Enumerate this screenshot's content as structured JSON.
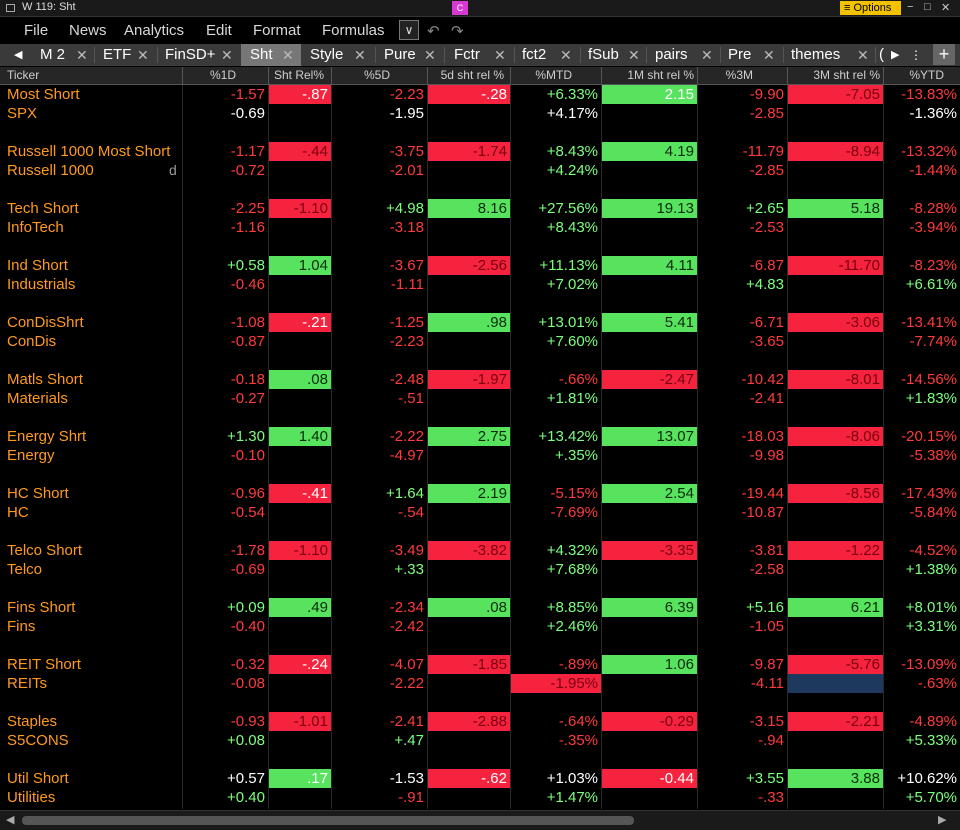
{
  "window": {
    "title": "W 119: Sht",
    "badge": "C",
    "options_label": "≡ Options",
    "minimize": "−",
    "maximize": "□",
    "close": "✕"
  },
  "menu": [
    "File",
    "News",
    "Analytics",
    "Edit",
    "Format",
    "Formulas"
  ],
  "tabs": [
    {
      "label": "M 2",
      "close": "✕"
    },
    {
      "label": "ETF",
      "close": "✕"
    },
    {
      "label": "FinSD+",
      "close": "✕"
    },
    {
      "label": "Sht",
      "close": "✕",
      "active": true
    },
    {
      "label": "Style",
      "close": "✕"
    },
    {
      "label": "Pure",
      "close": "✕"
    },
    {
      "label": "Fctr",
      "close": "✕"
    },
    {
      "label": "fct2",
      "close": "✕"
    },
    {
      "label": "fSub",
      "close": "✕"
    },
    {
      "label": "pairs",
      "close": "✕"
    },
    {
      "label": "Pre",
      "close": "✕"
    },
    {
      "label": "themes",
      "close": "✕"
    },
    {
      "label": "(",
      "close": ""
    }
  ],
  "columns": [
    "Ticker",
    "%1D",
    "Sht Rel%",
    "%5D",
    "5d sht rel %",
    "%MTD",
    "1M sht rel %",
    "%3M",
    "3M sht rel %",
    "%YTD"
  ],
  "rows": [
    {
      "name": "Most Short",
      "short": true,
      "cells": [
        [
          "-1.57",
          "r",
          ""
        ],
        [
          "-.87",
          "w",
          "R"
        ],
        [
          "-2.23",
          "r",
          ""
        ],
        [
          "-.28",
          "w",
          "R"
        ],
        [
          "+6.33%",
          "g",
          ""
        ],
        [
          "2.15",
          "w",
          "G"
        ],
        [
          "-9.90",
          "r",
          ""
        ],
        [
          "-7.05",
          "r",
          "R"
        ],
        [
          "-13.83%",
          "r",
          ""
        ]
      ]
    },
    {
      "name": "SPX",
      "short": false,
      "cells": [
        [
          "-0.69",
          "w",
          ""
        ],
        [
          "",
          "",
          ""
        ],
        [
          "-1.95",
          "w",
          ""
        ],
        [
          "",
          "",
          ""
        ],
        [
          "+4.17%",
          "w",
          ""
        ],
        [
          "",
          "",
          ""
        ],
        [
          "-2.85",
          "r",
          ""
        ],
        [
          "",
          "",
          ""
        ],
        [
          "-1.36%",
          "w",
          ""
        ]
      ]
    },
    null,
    {
      "name": "Russell 1000 Most Short",
      "short": true,
      "cells": [
        [
          "-1.17",
          "r",
          ""
        ],
        [
          "-.44",
          "r",
          "R"
        ],
        [
          "-3.75",
          "r",
          ""
        ],
        [
          "-1.74",
          "r",
          "R"
        ],
        [
          "+8.43%",
          "g",
          ""
        ],
        [
          "4.19",
          "k",
          "G"
        ],
        [
          "-11.79",
          "r",
          ""
        ],
        [
          "-8.94",
          "r",
          "R"
        ],
        [
          "-13.32%",
          "r",
          ""
        ]
      ]
    },
    {
      "name": "Russell 1000",
      "short": false,
      "d": "d",
      "cells": [
        [
          "-0.72",
          "r",
          ""
        ],
        [
          "",
          "",
          ""
        ],
        [
          "-2.01",
          "r",
          ""
        ],
        [
          "",
          "",
          ""
        ],
        [
          "+4.24%",
          "g",
          ""
        ],
        [
          "",
          "",
          ""
        ],
        [
          "-2.85",
          "r",
          ""
        ],
        [
          "",
          "",
          ""
        ],
        [
          "-1.44%",
          "r",
          ""
        ]
      ]
    },
    null,
    {
      "name": "Tech Short",
      "short": true,
      "cells": [
        [
          "-2.25",
          "r",
          ""
        ],
        [
          "-1.10",
          "r",
          "R"
        ],
        [
          "+4.98",
          "g",
          ""
        ],
        [
          "8.16",
          "k",
          "G"
        ],
        [
          "+27.56%",
          "g",
          ""
        ],
        [
          "19.13",
          "k",
          "G"
        ],
        [
          "+2.65",
          "g",
          ""
        ],
        [
          "5.18",
          "k",
          "G"
        ],
        [
          "-8.28%",
          "r",
          ""
        ]
      ]
    },
    {
      "name": "InfoTech",
      "short": false,
      "cells": [
        [
          "-1.16",
          "r",
          ""
        ],
        [
          "",
          "",
          ""
        ],
        [
          "-3.18",
          "r",
          ""
        ],
        [
          "",
          "",
          ""
        ],
        [
          "+8.43%",
          "g",
          ""
        ],
        [
          "",
          "",
          ""
        ],
        [
          "-2.53",
          "r",
          ""
        ],
        [
          "",
          "",
          ""
        ],
        [
          "-3.94%",
          "r",
          ""
        ]
      ]
    },
    null,
    {
      "name": "Ind Short",
      "short": true,
      "cells": [
        [
          "+0.58",
          "g",
          ""
        ],
        [
          "1.04",
          "k",
          "G"
        ],
        [
          "-3.67",
          "r",
          ""
        ],
        [
          "-2.56",
          "r",
          "R"
        ],
        [
          "+11.13%",
          "g",
          ""
        ],
        [
          "4.11",
          "k",
          "G"
        ],
        [
          "-6.87",
          "r",
          ""
        ],
        [
          "-11.70",
          "r",
          "R"
        ],
        [
          "-8.23%",
          "r",
          ""
        ]
      ]
    },
    {
      "name": "Industrials",
      "short": false,
      "cells": [
        [
          "-0.46",
          "r",
          ""
        ],
        [
          "",
          "",
          ""
        ],
        [
          "-1.11",
          "r",
          ""
        ],
        [
          "",
          "",
          ""
        ],
        [
          "+7.02%",
          "g",
          ""
        ],
        [
          "",
          "",
          ""
        ],
        [
          "+4.83",
          "g",
          ""
        ],
        [
          "",
          "",
          ""
        ],
        [
          "+6.61%",
          "g",
          ""
        ]
      ]
    },
    null,
    {
      "name": "ConDisShrt",
      "short": true,
      "cells": [
        [
          "-1.08",
          "r",
          ""
        ],
        [
          "-.21",
          "w",
          "R"
        ],
        [
          "-1.25",
          "r",
          ""
        ],
        [
          ".98",
          "k",
          "G"
        ],
        [
          "+13.01%",
          "g",
          ""
        ],
        [
          "5.41",
          "k",
          "G"
        ],
        [
          "-6.71",
          "r",
          ""
        ],
        [
          "-3.06",
          "r",
          "R"
        ],
        [
          "-13.41%",
          "r",
          ""
        ]
      ]
    },
    {
      "name": "ConDis",
      "short": false,
      "cells": [
        [
          "-0.87",
          "r",
          ""
        ],
        [
          "",
          "",
          ""
        ],
        [
          "-2.23",
          "r",
          ""
        ],
        [
          "",
          "",
          ""
        ],
        [
          "+7.60%",
          "g",
          ""
        ],
        [
          "",
          "",
          ""
        ],
        [
          "-3.65",
          "r",
          ""
        ],
        [
          "",
          "",
          ""
        ],
        [
          "-7.74%",
          "r",
          ""
        ]
      ]
    },
    null,
    {
      "name": "Matls Short",
      "short": true,
      "cells": [
        [
          "-0.18",
          "r",
          ""
        ],
        [
          ".08",
          "k",
          "G"
        ],
        [
          "-2.48",
          "r",
          ""
        ],
        [
          "-1.97",
          "r",
          "R"
        ],
        [
          "-.66%",
          "r",
          ""
        ],
        [
          "-2.47",
          "r",
          "R"
        ],
        [
          "-10.42",
          "r",
          ""
        ],
        [
          "-8.01",
          "r",
          "R"
        ],
        [
          "-14.56%",
          "r",
          ""
        ]
      ]
    },
    {
      "name": "Materials",
      "short": false,
      "cells": [
        [
          "-0.27",
          "r",
          ""
        ],
        [
          "",
          "",
          ""
        ],
        [
          "-.51",
          "r",
          ""
        ],
        [
          "",
          "",
          ""
        ],
        [
          "+1.81%",
          "g",
          ""
        ],
        [
          "",
          "",
          ""
        ],
        [
          "-2.41",
          "r",
          ""
        ],
        [
          "",
          "",
          ""
        ],
        [
          "+1.83%",
          "g",
          ""
        ]
      ]
    },
    null,
    {
      "name": "Energy Shrt",
      "short": true,
      "cells": [
        [
          "+1.30",
          "g",
          ""
        ],
        [
          "1.40",
          "k",
          "G"
        ],
        [
          "-2.22",
          "r",
          ""
        ],
        [
          "2.75",
          "k",
          "G"
        ],
        [
          "+13.42%",
          "g",
          ""
        ],
        [
          "13.07",
          "k",
          "G"
        ],
        [
          "-18.03",
          "r",
          ""
        ],
        [
          "-8.06",
          "r",
          "R"
        ],
        [
          "-20.15%",
          "r",
          ""
        ]
      ]
    },
    {
      "name": "Energy",
      "short": false,
      "cells": [
        [
          "-0.10",
          "r",
          ""
        ],
        [
          "",
          "",
          ""
        ],
        [
          "-4.97",
          "r",
          ""
        ],
        [
          "",
          "",
          ""
        ],
        [
          "+.35%",
          "g",
          ""
        ],
        [
          "",
          "",
          ""
        ],
        [
          "-9.98",
          "r",
          ""
        ],
        [
          "",
          "",
          ""
        ],
        [
          "-5.38%",
          "r",
          ""
        ]
      ]
    },
    null,
    {
      "name": "HC Short",
      "short": true,
      "cells": [
        [
          "-0.96",
          "r",
          ""
        ],
        [
          "-.41",
          "w",
          "R"
        ],
        [
          "+1.64",
          "g",
          ""
        ],
        [
          "2.19",
          "k",
          "G"
        ],
        [
          "-5.15%",
          "r",
          ""
        ],
        [
          "2.54",
          "k",
          "G"
        ],
        [
          "-19.44",
          "r",
          ""
        ],
        [
          "-8.56",
          "r",
          "R"
        ],
        [
          "-17.43%",
          "r",
          ""
        ]
      ]
    },
    {
      "name": "HC",
      "short": false,
      "cells": [
        [
          "-0.54",
          "r",
          ""
        ],
        [
          "",
          "",
          ""
        ],
        [
          "-.54",
          "r",
          ""
        ],
        [
          "",
          "",
          ""
        ],
        [
          "-7.69%",
          "r",
          ""
        ],
        [
          "",
          "",
          ""
        ],
        [
          "-10.87",
          "r",
          ""
        ],
        [
          "",
          "",
          ""
        ],
        [
          "-5.84%",
          "r",
          ""
        ]
      ]
    },
    null,
    {
      "name": "Telco Short",
      "short": true,
      "cells": [
        [
          "-1.78",
          "r",
          ""
        ],
        [
          "-1.10",
          "r",
          "R"
        ],
        [
          "-3.49",
          "r",
          ""
        ],
        [
          "-3.82",
          "r",
          "R"
        ],
        [
          "+4.32%",
          "g",
          ""
        ],
        [
          "-3.35",
          "r",
          "R"
        ],
        [
          "-3.81",
          "r",
          ""
        ],
        [
          "-1.22",
          "r",
          "R"
        ],
        [
          "-4.52%",
          "r",
          ""
        ]
      ]
    },
    {
      "name": "Telco",
      "short": false,
      "cells": [
        [
          "-0.69",
          "r",
          ""
        ],
        [
          "",
          "",
          ""
        ],
        [
          "+.33",
          "g",
          ""
        ],
        [
          "",
          "",
          ""
        ],
        [
          "+7.68%",
          "g",
          ""
        ],
        [
          "",
          "",
          ""
        ],
        [
          "-2.58",
          "r",
          ""
        ],
        [
          "",
          "",
          ""
        ],
        [
          "+1.38%",
          "g",
          ""
        ]
      ]
    },
    null,
    {
      "name": "Fins Short",
      "short": true,
      "cells": [
        [
          "+0.09",
          "g",
          ""
        ],
        [
          ".49",
          "k",
          "G"
        ],
        [
          "-2.34",
          "r",
          ""
        ],
        [
          ".08",
          "k",
          "G"
        ],
        [
          "+8.85%",
          "g",
          ""
        ],
        [
          "6.39",
          "k",
          "G"
        ],
        [
          "+5.16",
          "g",
          ""
        ],
        [
          "6.21",
          "k",
          "G"
        ],
        [
          "+8.01%",
          "g",
          ""
        ]
      ]
    },
    {
      "name": "Fins",
      "short": false,
      "cells": [
        [
          "-0.40",
          "r",
          ""
        ],
        [
          "",
          "",
          ""
        ],
        [
          "-2.42",
          "r",
          ""
        ],
        [
          "",
          "",
          ""
        ],
        [
          "+2.46%",
          "g",
          ""
        ],
        [
          "",
          "",
          ""
        ],
        [
          "-1.05",
          "r",
          ""
        ],
        [
          "",
          "",
          ""
        ],
        [
          "+3.31%",
          "g",
          ""
        ]
      ]
    },
    null,
    {
      "name": "REIT Short",
      "short": true,
      "cells": [
        [
          "-0.32",
          "r",
          ""
        ],
        [
          "-.24",
          "w",
          "R"
        ],
        [
          "-4.07",
          "r",
          ""
        ],
        [
          "-1.85",
          "r",
          "R"
        ],
        [
          "-.89%",
          "r",
          ""
        ],
        [
          "1.06",
          "k",
          "G"
        ],
        [
          "-9.87",
          "r",
          ""
        ],
        [
          "-5.76",
          "r",
          "R"
        ],
        [
          "-13.09%",
          "r",
          ""
        ]
      ]
    },
    {
      "name": "REITs",
      "short": false,
      "cells": [
        [
          "-0.08",
          "r",
          ""
        ],
        [
          "",
          "",
          ""
        ],
        [
          "-2.22",
          "r",
          ""
        ],
        [
          "",
          "",
          ""
        ],
        [
          "-1.95%",
          "r",
          "R"
        ],
        [
          "",
          "",
          ""
        ],
        [
          "-4.11",
          "r",
          ""
        ],
        [
          "",
          "",
          "B"
        ],
        [
          "-.63%",
          "r",
          ""
        ]
      ]
    },
    null,
    {
      "name": "Staples",
      "short": true,
      "cells": [
        [
          "-0.93",
          "r",
          ""
        ],
        [
          "-1.01",
          "r",
          "R"
        ],
        [
          "-2.41",
          "r",
          ""
        ],
        [
          "-2.88",
          "r",
          "R"
        ],
        [
          "-.64%",
          "r",
          ""
        ],
        [
          "-0.29",
          "r",
          "R"
        ],
        [
          "-3.15",
          "r",
          ""
        ],
        [
          "-2.21",
          "r",
          "R"
        ],
        [
          "-4.89%",
          "r",
          ""
        ]
      ]
    },
    {
      "name": "S5CONS",
      "short": false,
      "cells": [
        [
          "+0.08",
          "g",
          ""
        ],
        [
          "",
          "",
          ""
        ],
        [
          "+.47",
          "g",
          ""
        ],
        [
          "",
          "",
          ""
        ],
        [
          "-.35%",
          "r",
          ""
        ],
        [
          "",
          "",
          ""
        ],
        [
          "-.94",
          "r",
          ""
        ],
        [
          "",
          "",
          ""
        ],
        [
          "+5.33%",
          "g",
          ""
        ]
      ]
    },
    null,
    {
      "name": "Util Short",
      "short": true,
      "cells": [
        [
          "+0.57",
          "w",
          ""
        ],
        [
          ".17",
          "w",
          "G"
        ],
        [
          "-1.53",
          "w",
          ""
        ],
        [
          "-.62",
          "w",
          "R"
        ],
        [
          "+1.03%",
          "w",
          ""
        ],
        [
          "-0.44",
          "w",
          "R"
        ],
        [
          "+3.55",
          "g",
          ""
        ],
        [
          "3.88",
          "k",
          "G"
        ],
        [
          "+10.62%",
          "w",
          ""
        ]
      ]
    },
    {
      "name": "Utilities",
      "short": false,
      "cells": [
        [
          "+0.40",
          "g",
          ""
        ],
        [
          "",
          "",
          ""
        ],
        [
          "-.91",
          "r",
          ""
        ],
        [
          "",
          "",
          ""
        ],
        [
          "+1.47%",
          "g",
          ""
        ],
        [
          "",
          "",
          ""
        ],
        [
          "-.33",
          "r",
          ""
        ],
        [
          "",
          "",
          ""
        ],
        [
          "+5.70%",
          "g",
          ""
        ]
      ]
    }
  ]
}
